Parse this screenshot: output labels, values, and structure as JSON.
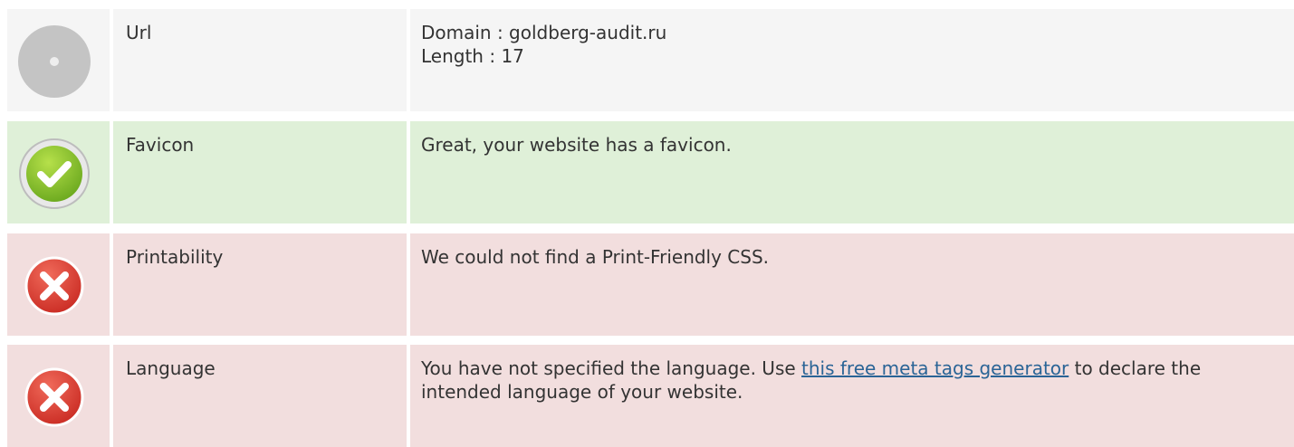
{
  "rows": [
    {
      "status": "neutral",
      "icon": "circle-neutral-icon",
      "label": "Url",
      "lines": [
        "Domain : goldberg-audit.ru",
        "Length : 17"
      ]
    },
    {
      "status": "good",
      "icon": "check-circle-icon",
      "label": "Favicon",
      "text": "Great, your website has a favicon."
    },
    {
      "status": "bad",
      "icon": "error-x-icon",
      "label": "Printability",
      "text": "We could not find a Print-Friendly CSS."
    },
    {
      "status": "bad",
      "icon": "error-x-icon",
      "label": "Language",
      "text_before": "You have not specified the language. Use ",
      "link_text": "this free meta tags generator",
      "text_after": " to declare the intended language of your website."
    }
  ],
  "colors": {
    "neutral_bg": "#f5f5f5",
    "good_bg": "#dff0d8",
    "bad_bg": "#f2dede",
    "link": "#2a6496"
  }
}
